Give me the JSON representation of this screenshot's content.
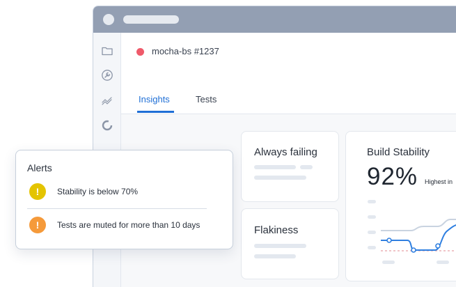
{
  "build": {
    "name": "mocha-bs #1237",
    "status_color": "#ef5a6a"
  },
  "tabs": [
    {
      "label": "Insights",
      "active": true
    },
    {
      "label": "Tests",
      "active": false
    }
  ],
  "sidebar": {
    "icons": [
      "folder-icon",
      "wrench-icon",
      "trend-icon",
      "donut-icon"
    ]
  },
  "cards": {
    "always_failing": {
      "title": "Always failing"
    },
    "flakiness": {
      "title": "Flakiness"
    },
    "build_stability": {
      "title": "Build Stability",
      "value": "92%",
      "caption": "Highest in"
    }
  },
  "alerts": {
    "title": "Alerts",
    "items": [
      {
        "text": "Stability is below 70%",
        "icon": "warning-icon",
        "color": "#e4c400"
      },
      {
        "text": "Tests are muted for more than 10 days",
        "icon": "warning-icon",
        "color": "#f59a3a"
      }
    ]
  },
  "colors": {
    "accent": "#1f6fd6",
    "titlebar": "#939fb3"
  }
}
